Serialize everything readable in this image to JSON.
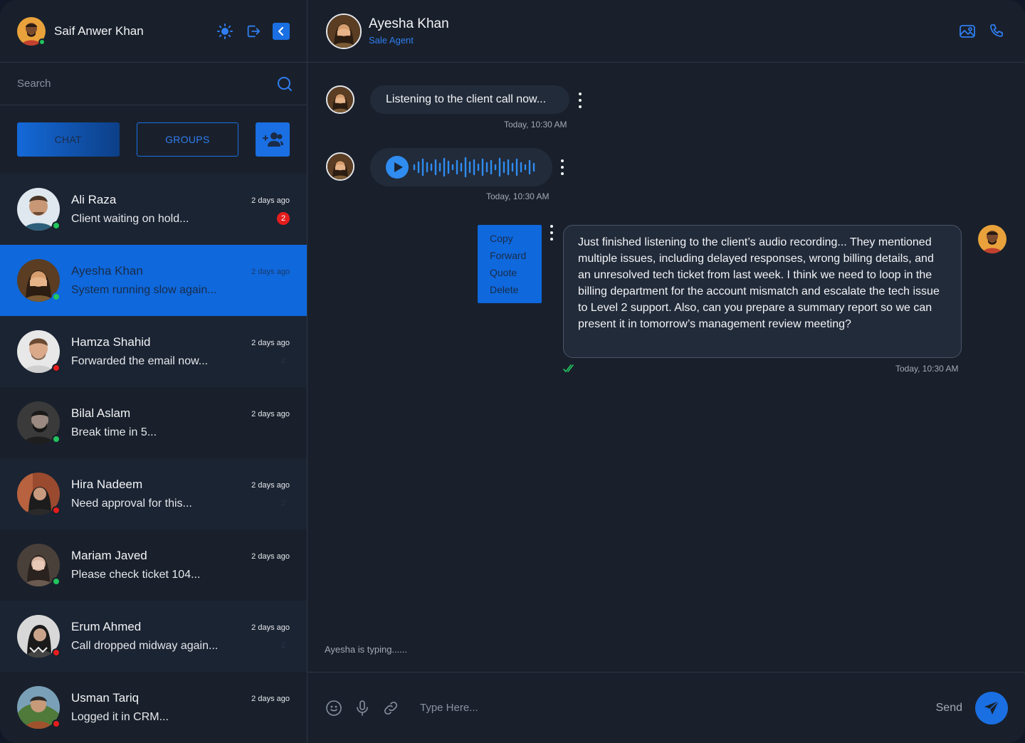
{
  "user": {
    "name": "Saif Anwer Khan",
    "status_color": "#22c55e"
  },
  "search": {
    "placeholder": "Search"
  },
  "tabs": {
    "chat": "CHAT",
    "groups": "GROUPS"
  },
  "icons": {
    "theme": "sun-icon",
    "logout": "logout-icon",
    "collapse": "chevron-left-icon",
    "search": "search-icon",
    "add_group": "add-users-icon",
    "gallery": "image-icon",
    "call": "phone-icon",
    "emoji": "emoji-icon",
    "mic": "microphone-icon",
    "attach": "link-icon",
    "send": "send-icon"
  },
  "colors": {
    "accent": "#1a6fe3",
    "online": "#22c55e",
    "offline": "#e51d1d",
    "read_tick": "#22c55e"
  },
  "chats": [
    {
      "name": "Ali Raza",
      "preview": "Client waiting on hold...",
      "time": "2 days ago",
      "unread": "2",
      "online": true
    },
    {
      "name": "Ayesha Khan",
      "preview": "System running slow again...",
      "time": "2 days ago",
      "unread": "",
      "online": true
    },
    {
      "name": "Hamza Shahid",
      "preview": "Forwarded the email now...",
      "time": "2 days ago",
      "unread": "2",
      "online": false
    },
    {
      "name": "Bilal Aslam",
      "preview": "Break time in 5...",
      "time": "2 days ago",
      "unread": "",
      "online": true
    },
    {
      "name": "Hira Nadeem",
      "preview": "Need approval for this...",
      "time": "2 days ago",
      "unread": "2",
      "online": false
    },
    {
      "name": "Mariam Javed",
      "preview": "Please check ticket 104...",
      "time": "2 days ago",
      "unread": "",
      "online": true
    },
    {
      "name": "Erum Ahmed",
      "preview": "Call dropped midway again...",
      "time": "2 days ago",
      "unread": "2",
      "online": false
    },
    {
      "name": "Usman Tariq",
      "preview": "Logged it in CRM...",
      "time": "2 days ago",
      "unread": "",
      "online": false
    }
  ],
  "conversation": {
    "peer_name": "Ayesha Khan",
    "peer_role": "Sale Agent",
    "messages": [
      {
        "text": "Listening to the client call now...",
        "time": "Today, 10:30 AM"
      },
      {
        "type": "audio",
        "time": "Today, 10:30 AM"
      },
      {
        "text": "Just finished listening to the client’s audio recording... They mentioned multiple issues, including delayed responses, wrong billing details, and an unresolved tech ticket from last week. I think we need to loop in the billing department for the account mismatch and escalate the tech issue to Level 2 support. Also, can you prepare a summary report so we can present it in tomorrow’s management review meeting?",
        "time": "Today, 10:30 AM"
      }
    ],
    "context_menu": [
      "Copy",
      "Forward",
      "Quote",
      "Delete"
    ],
    "typing": "Ayesha is typing......"
  },
  "composer": {
    "placeholder": "Type Here...",
    "send_label": "Send"
  }
}
